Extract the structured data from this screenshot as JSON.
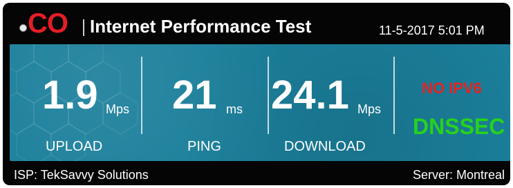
{
  "header": {
    "brand": "CO",
    "title": "Internet Performance Test",
    "datetime": "11-5-2017 5:01 PM"
  },
  "metrics": {
    "upload": {
      "value": "1.9",
      "unit": "Mps",
      "label": "UPLOAD"
    },
    "ping": {
      "value": "21",
      "unit": "ms",
      "label": "PING"
    },
    "download": {
      "value": "24.1",
      "unit": "Mps",
      "label": "DOWNLOAD"
    }
  },
  "status": {
    "ipv6": "NO IPV6",
    "dnssec": "DNSSEC",
    "ipv6_color": "#e52320",
    "dnssec_color": "#27d21d"
  },
  "footer": {
    "isp": "ISP: TekSavvy Solutions",
    "server": "Server: Montreal"
  },
  "colors": {
    "panel": "#1b7f9b",
    "background": "#050505",
    "brand": "#e41e25"
  },
  "icons": {
    "logo_dot": "globe-dot-icon"
  }
}
